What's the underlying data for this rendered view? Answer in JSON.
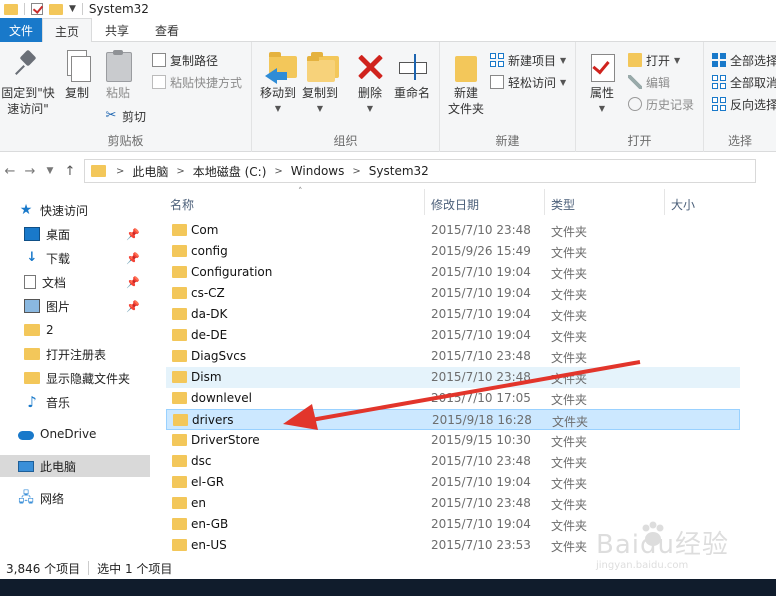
{
  "window": {
    "title": "System32"
  },
  "ribbon_tabs": [
    "文件",
    "主页",
    "共享",
    "查看"
  ],
  "ribbon": {
    "clipboard": {
      "pin_label": "固定到\"快速访问\"",
      "copy_label": "复制",
      "paste_label": "粘贴",
      "copy_path_label": "复制路径",
      "paste_shortcut_label": "粘贴快捷方式",
      "cut_label": "剪切",
      "group_label": "剪贴板"
    },
    "organize": {
      "move_to_label": "移动到",
      "copy_to_label": "复制到",
      "delete_label": "删除",
      "rename_label": "重命名",
      "group_label": "组织"
    },
    "new": {
      "new_folder_label": "新建\n文件夹",
      "new_item_label": "新建项目",
      "easy_access_label": "轻松访问",
      "group_label": "新建"
    },
    "open": {
      "properties_label": "属性",
      "open_label": "打开",
      "edit_label": "编辑",
      "history_label": "历史记录",
      "group_label": "打开"
    },
    "select": {
      "select_all_label": "全部选择",
      "select_none_label": "全部取消",
      "invert_label": "反向选择",
      "group_label": "选择"
    }
  },
  "breadcrumb": [
    "此电脑",
    "本地磁盘 (C:)",
    "Windows",
    "System32"
  ],
  "sidebar": {
    "items": [
      {
        "label": "快速访问",
        "icon": "star-icon"
      },
      {
        "label": "桌面",
        "icon": "desktop-icon",
        "pinned": true
      },
      {
        "label": "下载",
        "icon": "download-icon",
        "pinned": true
      },
      {
        "label": "文档",
        "icon": "document-icon",
        "pinned": true
      },
      {
        "label": "图片",
        "icon": "picture-icon",
        "pinned": true
      },
      {
        "label": "2",
        "icon": "folder-icon"
      },
      {
        "label": "打开注册表",
        "icon": "folder-icon"
      },
      {
        "label": "显示隐藏文件夹",
        "icon": "folder-icon"
      },
      {
        "label": "音乐",
        "icon": "music-icon"
      },
      {
        "label": "OneDrive",
        "icon": "cloud-icon"
      },
      {
        "label": "此电脑",
        "icon": "computer-icon",
        "selected": true
      },
      {
        "label": "网络",
        "icon": "network-icon"
      }
    ]
  },
  "columns": {
    "name": "名称",
    "date": "修改日期",
    "type": "类型",
    "size": "大小"
  },
  "files": [
    {
      "name": "Com",
      "date": "2015/7/10 23:48",
      "type": "文件夹"
    },
    {
      "name": "config",
      "date": "2015/9/26 15:49",
      "type": "文件夹"
    },
    {
      "name": "Configuration",
      "date": "2015/7/10 19:04",
      "type": "文件夹"
    },
    {
      "name": "cs-CZ",
      "date": "2015/7/10 19:04",
      "type": "文件夹"
    },
    {
      "name": "da-DK",
      "date": "2015/7/10 19:04",
      "type": "文件夹"
    },
    {
      "name": "de-DE",
      "date": "2015/7/10 19:04",
      "type": "文件夹"
    },
    {
      "name": "DiagSvcs",
      "date": "2015/7/10 23:48",
      "type": "文件夹"
    },
    {
      "name": "Dism",
      "date": "2015/7/10 23:48",
      "type": "文件夹",
      "hover": true
    },
    {
      "name": "downlevel",
      "date": "2015/7/10 17:05",
      "type": "文件夹"
    },
    {
      "name": "drivers",
      "date": "2015/9/18 16:28",
      "type": "文件夹",
      "selected": true
    },
    {
      "name": "DriverStore",
      "date": "2015/9/15 10:30",
      "type": "文件夹"
    },
    {
      "name": "dsc",
      "date": "2015/7/10 23:48",
      "type": "文件夹"
    },
    {
      "name": "el-GR",
      "date": "2015/7/10 19:04",
      "type": "文件夹"
    },
    {
      "name": "en",
      "date": "2015/7/10 23:48",
      "type": "文件夹"
    },
    {
      "name": "en-GB",
      "date": "2015/7/10 19:04",
      "type": "文件夹"
    },
    {
      "name": "en-US",
      "date": "2015/7/10 23:53",
      "type": "文件夹"
    }
  ],
  "status": {
    "item_count": "3,846 个项目",
    "selected": "选中 1 个项目"
  },
  "watermark": {
    "brand": "Baidu经验",
    "url": "jingyan.baidu.com"
  },
  "colors": {
    "accent": "#1979ca",
    "folder": "#f3c75a",
    "selection": "#cce8ff",
    "annotation_arrow": "#e2352b"
  }
}
